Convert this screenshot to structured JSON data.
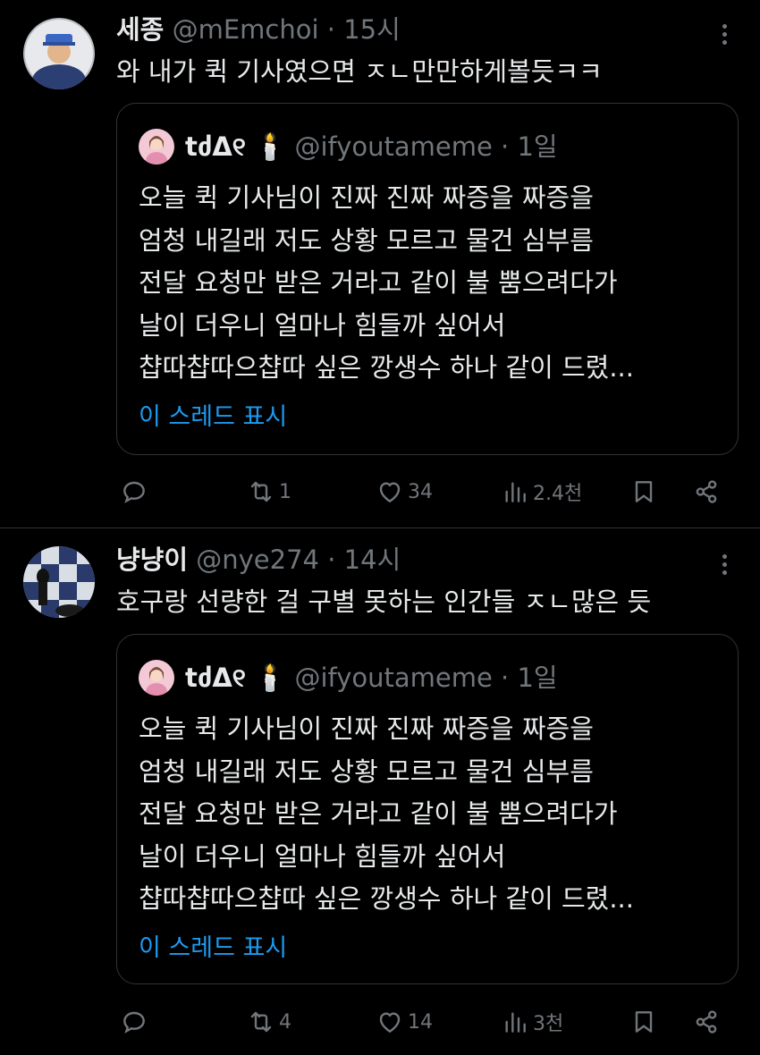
{
  "tweets": [
    {
      "name": "세종",
      "handle": "@mEmchoi",
      "dot": "·",
      "time": "15시",
      "text": "와 내가 퀵 기사였으면 ㅈㄴ만만하게볼듯ㅋㅋ",
      "quote": {
        "name": "tძΔ୧",
        "name_emoji": "🕯️",
        "handle": "@ifyoutameme",
        "dot": "·",
        "time": "1일",
        "lines": [
          "오늘 퀵 기사님이 진짜 진짜 짜증을 짜증을",
          "엄청 내길래 저도 상황 모르고 물건 심부름",
          "전달 요청만 받은 거라고 같이 불 뿜으려다가",
          "날이 더우니 얼마나 힘들까 싶어서",
          "챱따챱따으챱따 싶은 깡생수 하나 같이 드렸..."
        ],
        "show_thread": "이 스레드 표시"
      },
      "reply_count": "",
      "retweet_count": "1",
      "like_count": "34",
      "view_count": "2.4천"
    },
    {
      "name": "냥냥이",
      "handle": "@nye274",
      "dot": "·",
      "time": "14시",
      "text": "호구랑 선량한 걸 구별 못하는 인간들 ㅈㄴ많은 듯",
      "quote": {
        "name": "tძΔ୧",
        "name_emoji": "🕯️",
        "handle": "@ifyoutameme",
        "dot": "·",
        "time": "1일",
        "lines": [
          "오늘 퀵 기사님이 진짜 진짜 짜증을 짜증을",
          "엄청 내길래 저도 상황 모르고 물건 심부름",
          "전달 요청만 받은 거라고 같이 불 뿜으려다가",
          "날이 더우니 얼마나 힘들까 싶어서",
          "챱따챱따으챱따 싶은 깡생수 하나 같이 드렸..."
        ],
        "show_thread": "이 스레드 표시"
      },
      "reply_count": "",
      "retweet_count": "4",
      "like_count": "14",
      "view_count": "3천"
    }
  ],
  "colors": {
    "background": "#000000",
    "text": "#e7e9ea",
    "muted": "#71767b",
    "link": "#1d9bf0",
    "border": "#2f3336"
  },
  "icons": [
    "reply-icon",
    "retweet-icon",
    "like-icon",
    "views-icon",
    "bookmark-icon",
    "share-icon",
    "more-icon"
  ]
}
